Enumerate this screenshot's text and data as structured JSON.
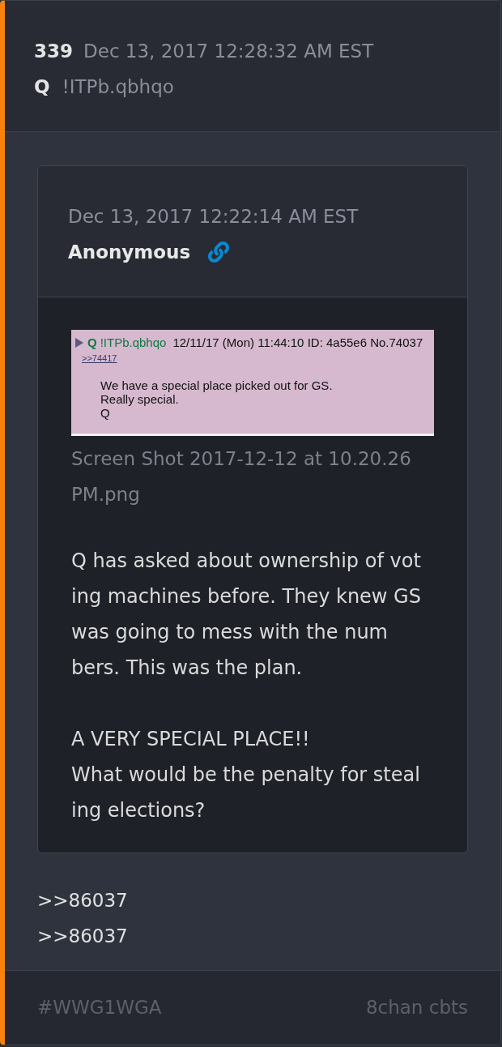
{
  "post": {
    "number": "339",
    "date": "Dec 13, 2017 12:28:32 AM EST",
    "author": "Q",
    "tripcode": "!ITPb.qbhqo"
  },
  "quoted_post": {
    "date": "Dec 13, 2017 12:22:14 AM EST",
    "author": "Anonymous",
    "attachment": {
      "screenshot": {
        "name": "Q",
        "tripcode": "!ITPb.qbhqo",
        "meta": "12/11/17 (Mon) 11:44:10 ID: 4a55e6 No.74037",
        "reply_link": ">>74417",
        "lines": [
          "We have a special place picked out for GS.",
          "Really special.",
          "Q"
        ]
      },
      "filename_lines": [
        "Screen Shot 2017-12-12 at 10.20.26",
        "PM.png"
      ]
    },
    "paragraphs": [
      [
        "Q has asked about ownership of vot",
        "ing machines before. They knew GS",
        "was going to mess with the num",
        "bers. This was the plan."
      ],
      [
        "A VERY SPECIAL PLACE!!",
        "What would be the penalty for steal",
        "ing elections?"
      ]
    ]
  },
  "reply_links": [
    ">>86037",
    ">>86037"
  ],
  "footer": {
    "tag": "#WWG1WGA",
    "source": "8chan cbts"
  }
}
